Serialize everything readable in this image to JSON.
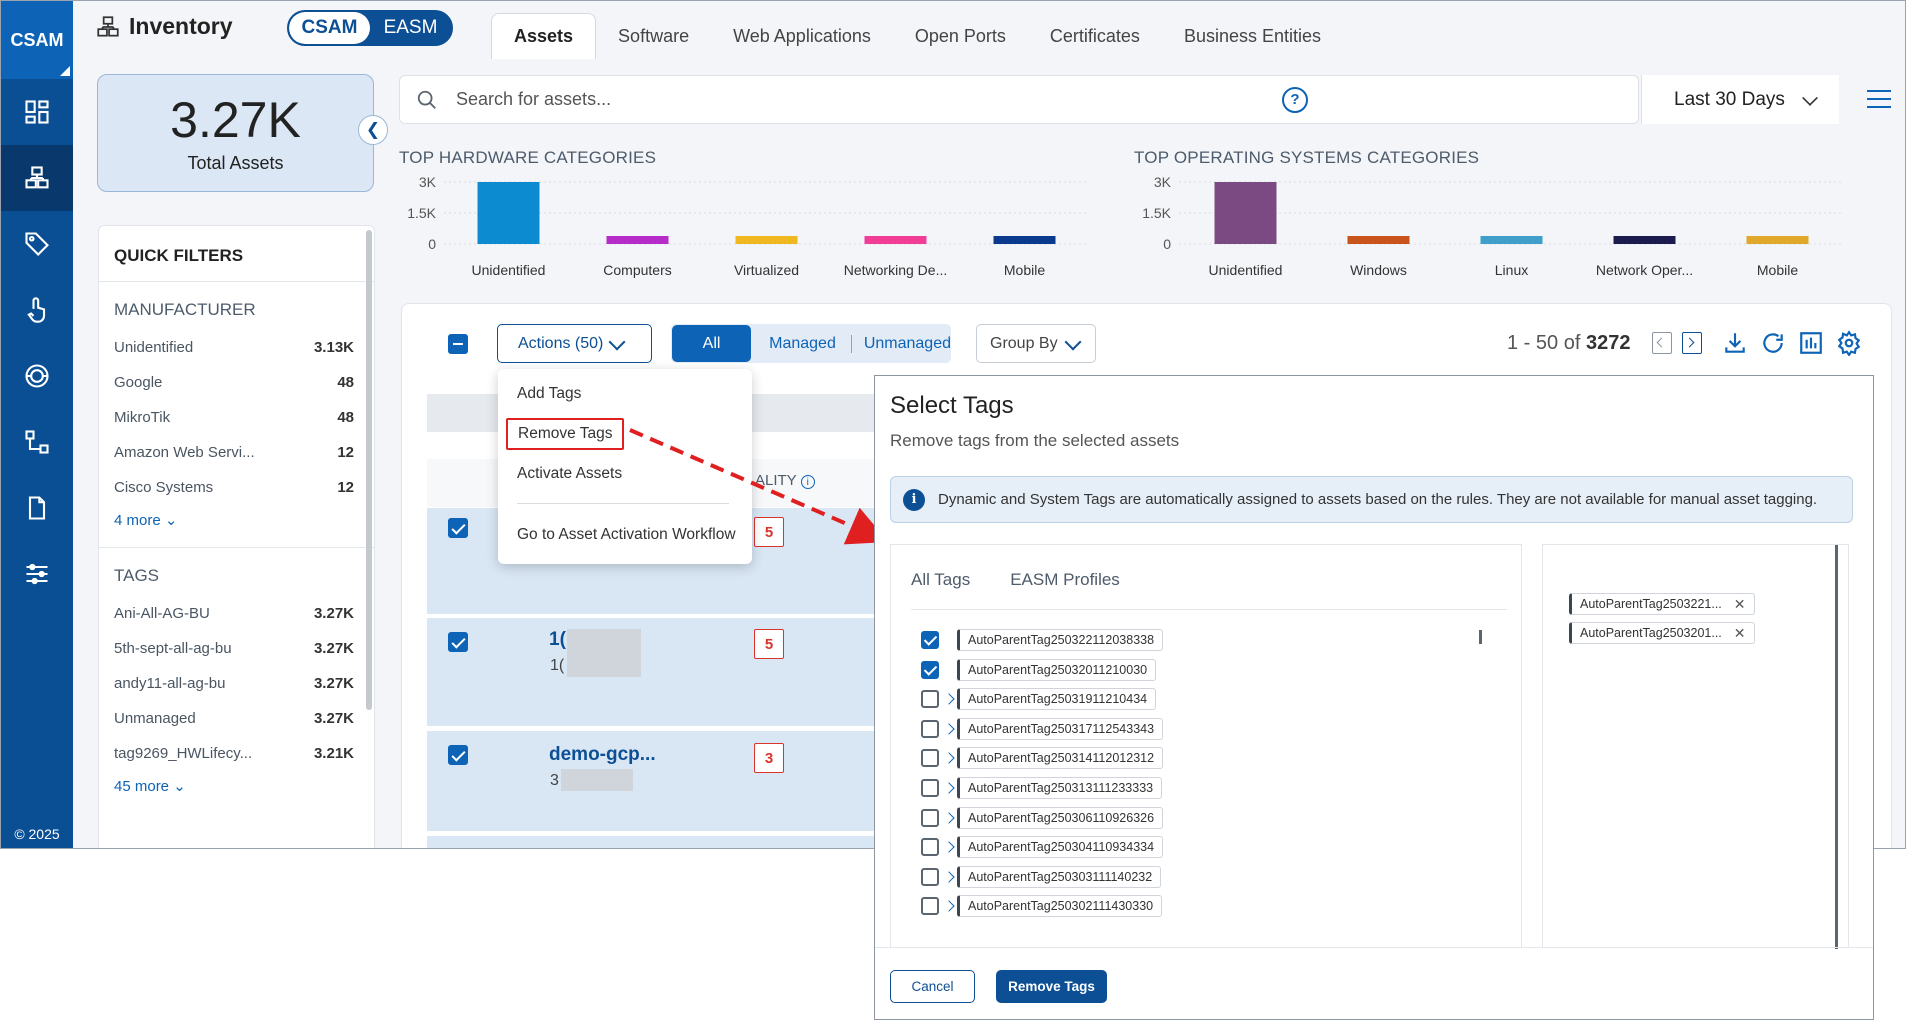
{
  "app": {
    "logo": "CSAM",
    "copyright": "© 2025",
    "title": "Inventory"
  },
  "toggle": {
    "left": "CSAM",
    "right": "EASM"
  },
  "tabs": [
    "Assets",
    "Software",
    "Web Applications",
    "Open Ports",
    "Certificates",
    "Business Entities"
  ],
  "kpi": {
    "value": "3.27K",
    "label": "Total Assets"
  },
  "search": {
    "placeholder": "Search for assets...",
    "help": "?"
  },
  "date_range": "Last 30 Days",
  "quick_filters": {
    "title": "QUICK FILTERS",
    "manufacturer": {
      "title": "MANUFACTURER",
      "items": [
        {
          "label": "Unidentified",
          "count": "3.13K"
        },
        {
          "label": "Google",
          "count": "48"
        },
        {
          "label": "MikroTik",
          "count": "48"
        },
        {
          "label": "Amazon Web Servi...",
          "count": "12"
        },
        {
          "label": "Cisco Systems",
          "count": "12"
        }
      ],
      "more": "4 more"
    },
    "tags": {
      "title": "TAGS",
      "items": [
        {
          "label": "Ani-All-AG-BU",
          "count": "3.27K"
        },
        {
          "label": "5th-sept-all-ag-bu",
          "count": "3.27K"
        },
        {
          "label": "andy11-all-ag-bu",
          "count": "3.27K"
        },
        {
          "label": "Unmanaged",
          "count": "3.27K"
        },
        {
          "label": "tag9269_HWLifecy...",
          "count": "3.21K"
        }
      ],
      "more": "45 more"
    }
  },
  "chart_data": [
    {
      "type": "bar",
      "title": "TOP HARDWARE CATEGORIES",
      "categories": [
        "Unidentified",
        "Computers",
        "Virtualized",
        "Networking De...",
        "Mobile"
      ],
      "values": [
        3130,
        45,
        40,
        45,
        40
      ],
      "ylim": [
        0,
        3000
      ],
      "yticks": [
        "3K",
        "1.5K",
        "0"
      ],
      "colors": [
        "#0d8bd0",
        "#b62cc9",
        "#f0b820",
        "#f23d96",
        "#0b3a8c"
      ]
    },
    {
      "type": "bar",
      "title": "TOP OPERATING SYSTEMS CATEGORIES",
      "categories": [
        "Unidentified",
        "Windows",
        "Linux",
        "Network Oper...",
        "Mobile"
      ],
      "values": [
        3120,
        40,
        40,
        40,
        40
      ],
      "ylim": [
        0,
        3000
      ],
      "yticks": [
        "3K",
        "1.5K",
        "0"
      ],
      "colors": [
        "#7b4a82",
        "#c8541c",
        "#3f9fc9",
        "#1b1c4d",
        "#e1a92b"
      ]
    }
  ],
  "grid": {
    "actions_label": "Actions (50)",
    "segments": [
      "All",
      "Managed",
      "Unmanaged"
    ],
    "group_by": "Group By",
    "pager": {
      "range": "1 - 50 of",
      "total": "3272"
    },
    "criticality_header": "ALITY",
    "rows": [
      {
        "crit": "5",
        "name": "",
        "sub": ""
      },
      {
        "crit": "5",
        "name": "1(",
        "sub": "1("
      },
      {
        "crit": "3",
        "name": "demo-gcp...",
        "sub": "3"
      }
    ]
  },
  "actions_menu": {
    "items": [
      "Add Tags",
      "Remove Tags",
      "Activate Assets",
      "Go to Asset Activation Workflow"
    ]
  },
  "modal": {
    "title": "Select Tags",
    "subtitle": "Remove tags from the selected assets",
    "info": "Dynamic and System Tags are automatically assigned to assets based on the rules. They are not available for manual asset tagging.",
    "tabs": [
      "All Tags",
      "EASM Profiles"
    ],
    "tags": [
      {
        "name": "AutoParentTag250322112038338",
        "checked": true,
        "expand": false
      },
      {
        "name": "AutoParentTag25032011210030",
        "checked": true,
        "expand": false
      },
      {
        "name": "AutoParentTag25031911210434",
        "checked": false,
        "expand": true
      },
      {
        "name": "AutoParentTag250317112543343",
        "checked": false,
        "expand": true
      },
      {
        "name": "AutoParentTag250314112012312",
        "checked": false,
        "expand": true
      },
      {
        "name": "AutoParentTag250313111233333",
        "checked": false,
        "expand": true
      },
      {
        "name": "AutoParentTag250306110926326",
        "checked": false,
        "expand": true
      },
      {
        "name": "AutoParentTag250304110934334",
        "checked": false,
        "expand": true
      },
      {
        "name": "AutoParentTag250303111140232",
        "checked": false,
        "expand": true
      },
      {
        "name": "AutoParentTag250302111430330",
        "checked": false,
        "expand": true
      }
    ],
    "selected": [
      "AutoParentTag2503221...",
      "AutoParentTag2503201..."
    ],
    "cancel": "Cancel",
    "confirm": "Remove Tags"
  }
}
